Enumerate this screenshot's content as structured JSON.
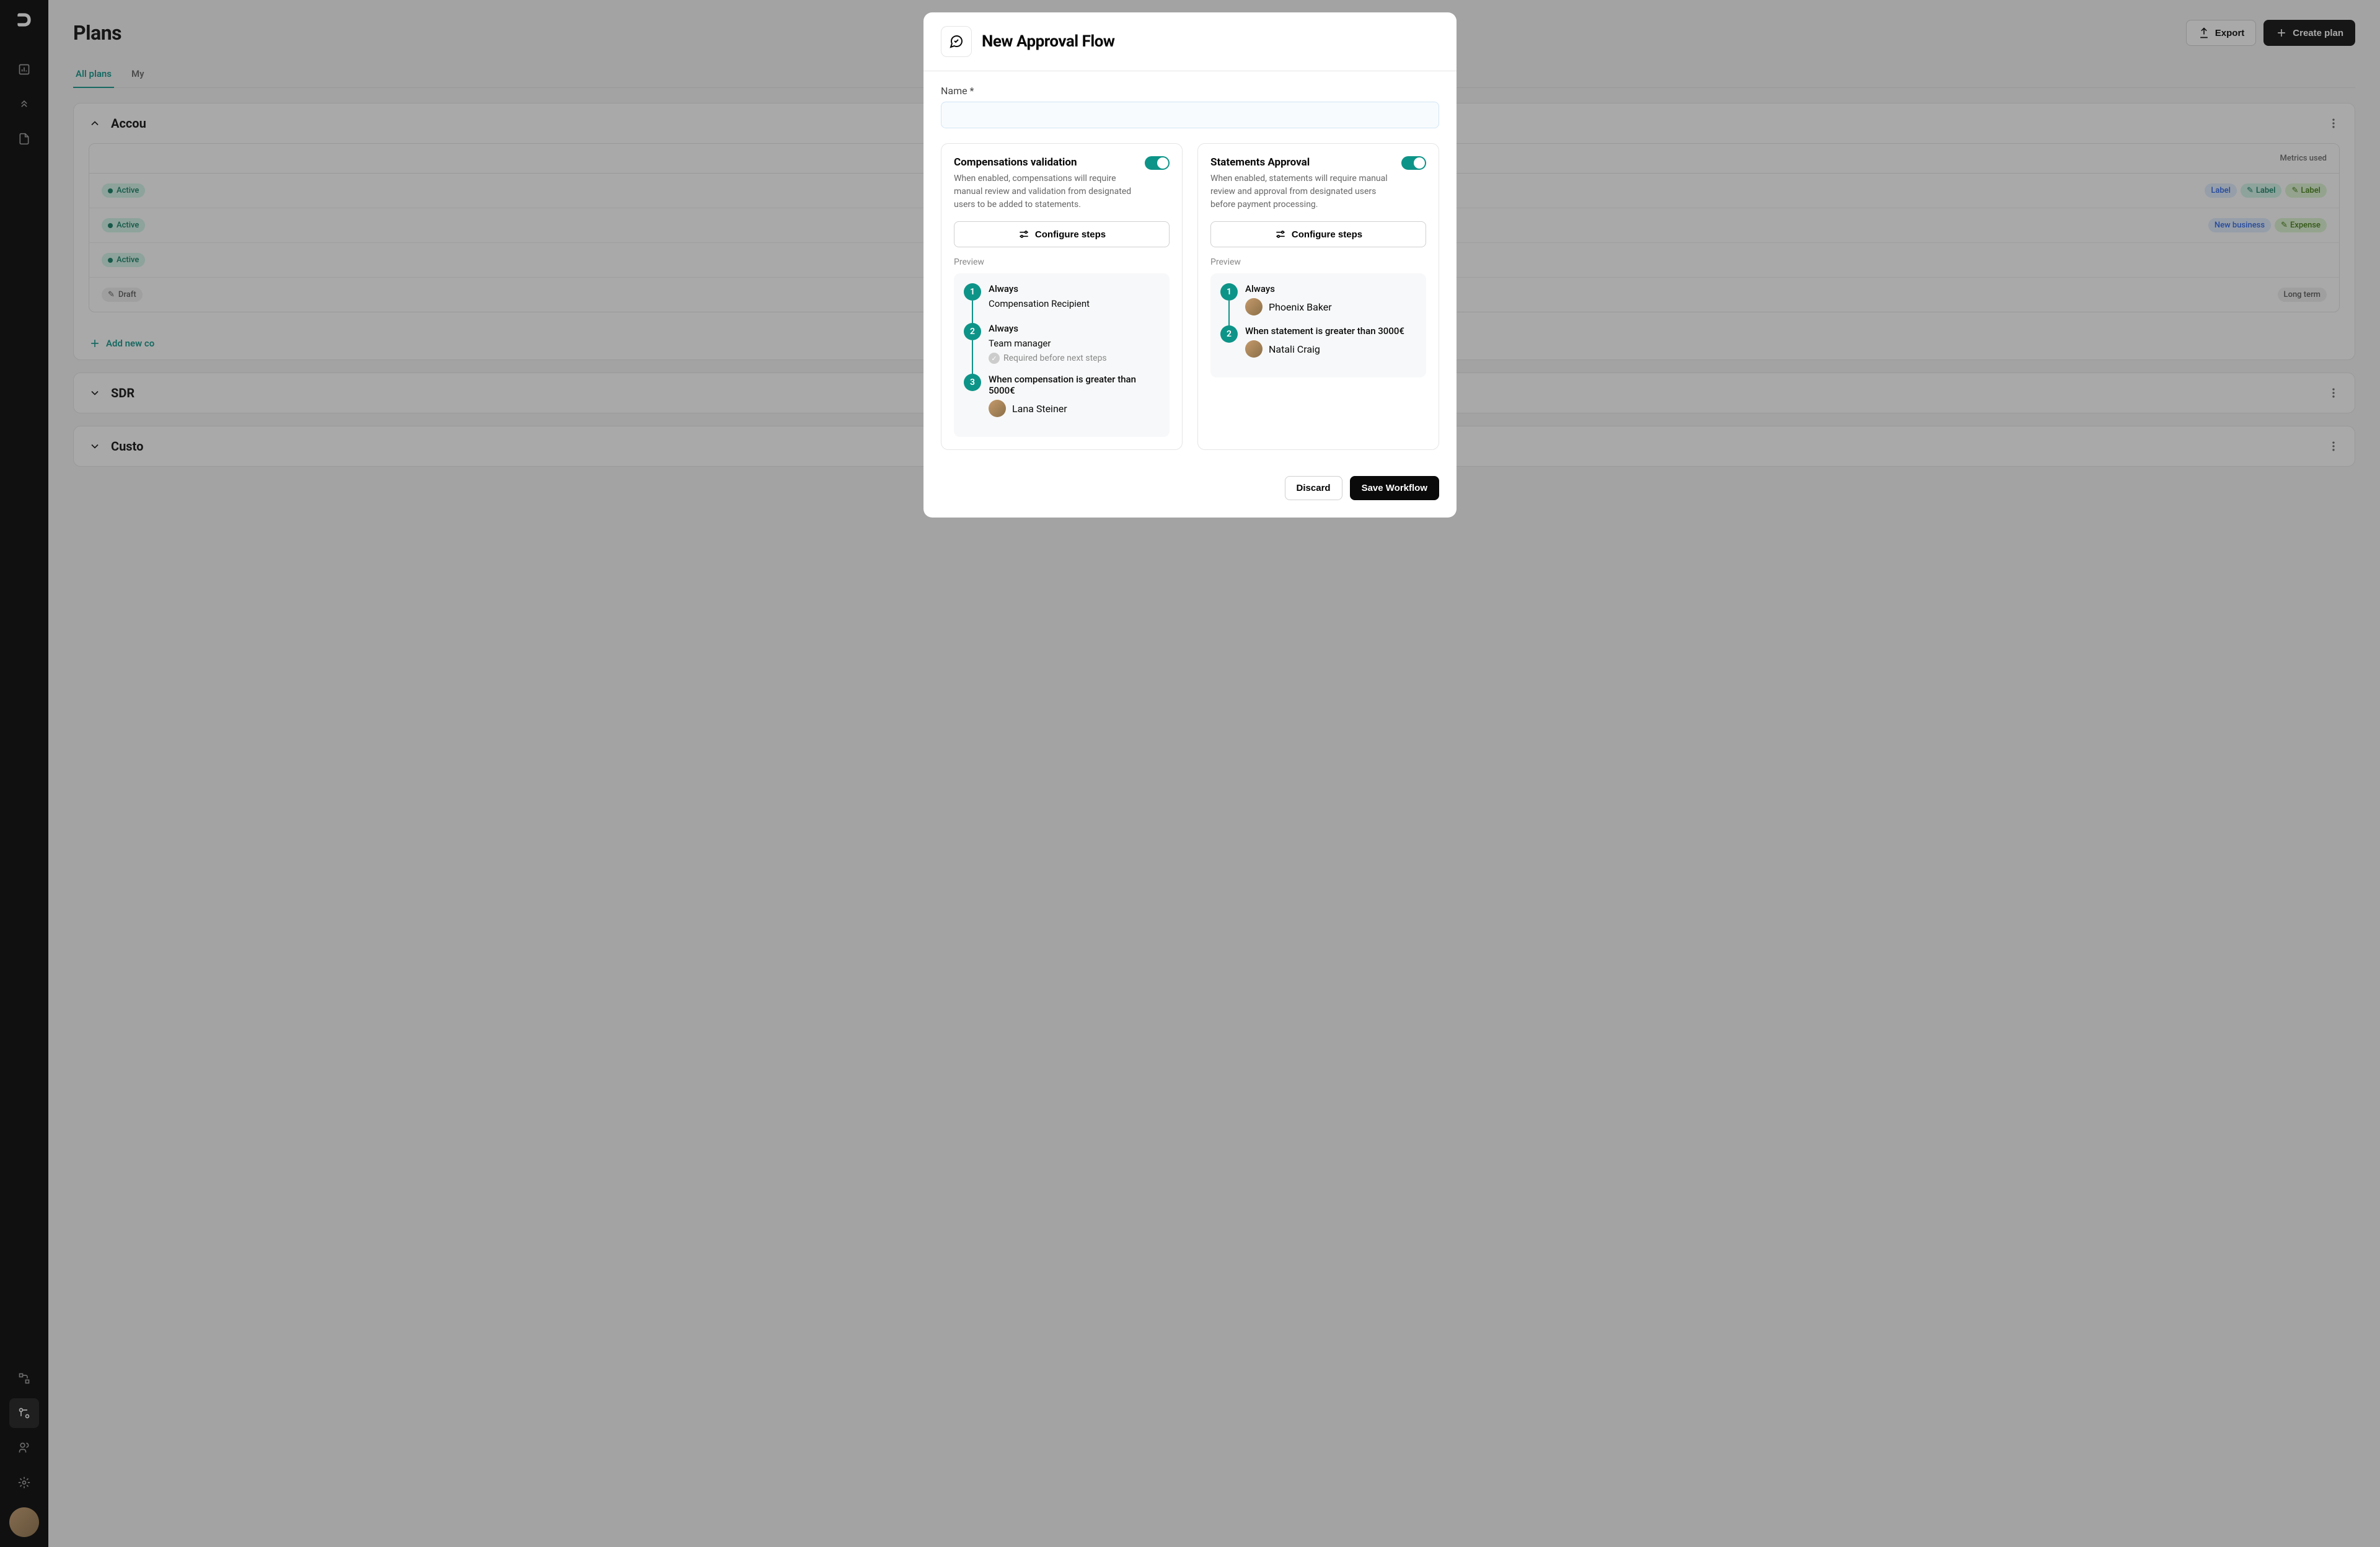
{
  "page": {
    "title": "Plans"
  },
  "header": {
    "export_label": "Export",
    "create_label": "Create plan"
  },
  "tabs": {
    "all": "All plans",
    "my": "My"
  },
  "groups": {
    "acct": "Accou",
    "sdr": "SDR",
    "cust": "Custo"
  },
  "table": {
    "header_metrics": "Metrics used",
    "status": {
      "active": "Active",
      "draft": "Draft"
    }
  },
  "tags": {
    "label": "Label",
    "new_business": "New business",
    "expenses": "Expense",
    "long_term": "Long term"
  },
  "add_link": "Add new co",
  "modal": {
    "title": "New Approval Flow",
    "name_label": "Name *",
    "discard": "Discard",
    "save": "Save Workflow",
    "configure_steps": "Configure steps",
    "preview": "Preview",
    "comp": {
      "title": "Compensations validation",
      "desc": "When enabled, compensations will require manual review and validation from designated users to be added to statements.",
      "steps": [
        {
          "num": "1",
          "cond": "Always",
          "role": "Compensation Recipient"
        },
        {
          "num": "2",
          "cond": "Always",
          "role": "Team manager",
          "note": "Required before next steps"
        },
        {
          "num": "3",
          "cond": "When compensation is greater than 5000€",
          "approver": "Lana Steiner"
        }
      ]
    },
    "stmt": {
      "title": "Statements Approval",
      "desc": "When enabled, statements will require manual review and approval from designated users before payment processing.",
      "steps": [
        {
          "num": "1",
          "cond": "Always",
          "approver": "Phoenix Baker"
        },
        {
          "num": "2",
          "cond": "When statement is greater than 3000€",
          "approver": "Natali Craig"
        }
      ]
    }
  }
}
